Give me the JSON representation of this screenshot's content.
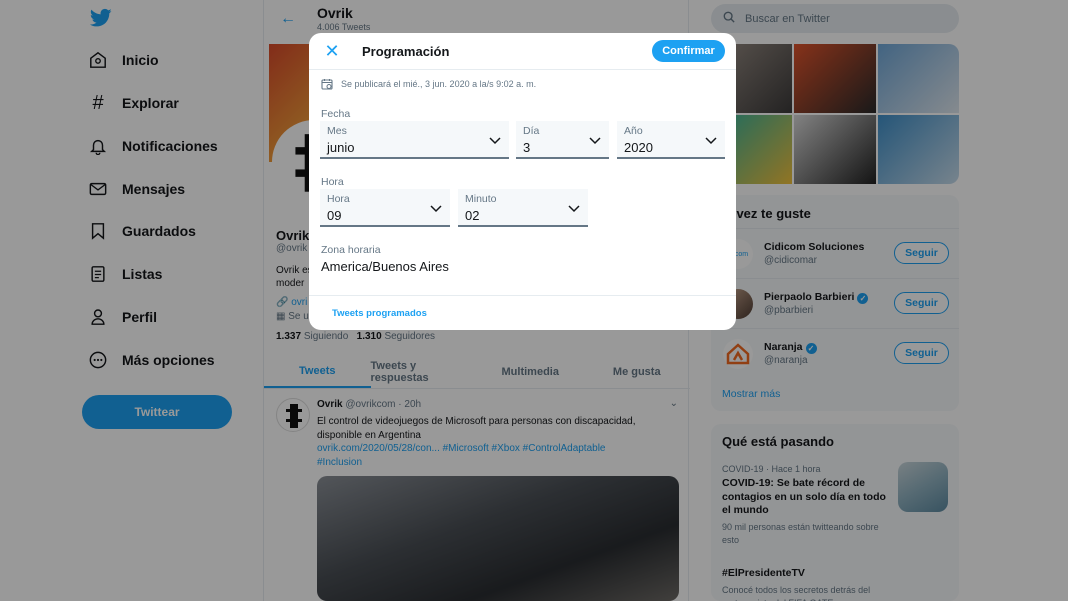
{
  "nav": {
    "items": [
      {
        "label": "Inicio",
        "icon": "home-icon"
      },
      {
        "label": "Explorar",
        "icon": "hashtag-icon"
      },
      {
        "label": "Notificaciones",
        "icon": "bell-icon"
      },
      {
        "label": "Mensajes",
        "icon": "envelope-icon"
      },
      {
        "label": "Guardados",
        "icon": "bookmark-icon"
      },
      {
        "label": "Listas",
        "icon": "list-icon"
      },
      {
        "label": "Perfil",
        "icon": "person-icon"
      },
      {
        "label": "Más opciones",
        "icon": "more-icon"
      }
    ],
    "tweet_button": "Twittear"
  },
  "profile": {
    "name": "Ovrik",
    "tweet_count": "4.006 Tweets",
    "display_name": "Ovrik",
    "handle": "@ovrik",
    "bio": "Ovrik es\nmoder",
    "link": "ovri",
    "joined": "Se u",
    "following_count": "1.337",
    "following_label": "Siguiendo",
    "followers_count": "1.310",
    "followers_label": "Seguidores"
  },
  "tabs": [
    "Tweets",
    "Tweets y respuestas",
    "Multimedia",
    "Me gusta"
  ],
  "tweet": {
    "author": "Ovrik",
    "handle": "@ovrikcom",
    "time": "· 20h",
    "text": "El control de videojuegos de Microsoft para personas con discapacidad, disponible en Argentina",
    "link_line": "ovrik.com/2020/05/28/con... #Microsoft #Xbox #ControlAdaptable",
    "tag_line": "#Inclusion"
  },
  "search": {
    "placeholder": "Buscar en Twitter"
  },
  "who_to_follow": {
    "title": "al vez te guste",
    "accounts": [
      {
        "name": "Cidicom Soluciones",
        "handle": "@cidicomar",
        "verified": false,
        "avatar_text": "idicom"
      },
      {
        "name": "Pierpaolo Barbieri",
        "handle": "@pbarbieri",
        "verified": true,
        "avatar_text": ""
      },
      {
        "name": "Naranja",
        "handle": "@naranja",
        "verified": true,
        "avatar_text": ""
      }
    ],
    "follow_label": "Seguir",
    "show_more": "Mostrar más"
  },
  "trends": {
    "title": "Qué está pasando",
    "items": [
      {
        "meta": "COVID-19 · Hace 1 hora",
        "title": "COVID-19: Se bate récord de contagios en un solo día en todo el mundo",
        "sub": "90 mil personas están twitteando sobre esto"
      },
      {
        "meta": "",
        "title": "#ElPresidenteTV",
        "sub": "Conocé todos los secretos detrás del protagonista del FIFA GATE"
      }
    ]
  },
  "modal": {
    "title": "Programación",
    "confirm": "Confirmar",
    "info": "Se publicará el mié., 3 jun. 2020 a la/s 9:02 a. m.",
    "date_label": "Fecha",
    "month": {
      "label": "Mes",
      "value": "junio"
    },
    "day": {
      "label": "Día",
      "value": "3"
    },
    "year": {
      "label": "Año",
      "value": "2020"
    },
    "time_label": "Hora",
    "hour": {
      "label": "Hora",
      "value": "09"
    },
    "minute": {
      "label": "Minuto",
      "value": "02"
    },
    "tz_label": "Zona horaria",
    "tz_value": "America/Buenos Aires",
    "scheduled_link": "Tweets programados"
  },
  "colors": {
    "accent": "#1da1f2",
    "text": "#14171a",
    "muted": "#657786",
    "overlay": "rgba(0,0,0,0.4)"
  }
}
